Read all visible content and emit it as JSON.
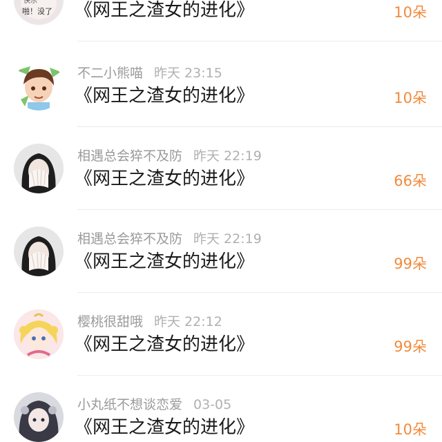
{
  "gifts": [
    {
      "user": "",
      "time": "",
      "title": "《网王之渣女的进化》",
      "amount": "10朵",
      "avatar_text": "快乐 啪！没了"
    },
    {
      "user": "不二小熊喵",
      "time": "昨天 23:15",
      "title": "《网王之渣女的进化》",
      "amount": "10朵"
    },
    {
      "user": "相遇总会猝不及防",
      "time": "昨天 22:19",
      "title": "《网王之渣女的进化》",
      "amount": "66朵"
    },
    {
      "user": "相遇总会猝不及防",
      "time": "昨天 22:19",
      "title": "《网王之渣女的进化》",
      "amount": "99朵"
    },
    {
      "user": "樱桃很甜哦",
      "time": "昨天 22:12",
      "title": "《网王之渣女的进化》",
      "amount": "99朵"
    },
    {
      "user": "小丸纸不想谈恋爱",
      "time": "03-05",
      "title": "《网王之渣女的进化》",
      "amount": "10朵"
    }
  ],
  "colors": {
    "accent": "#f28a3a",
    "username": "#9a9a9a",
    "title": "#1a1a1a",
    "divider": "#ececec"
  }
}
